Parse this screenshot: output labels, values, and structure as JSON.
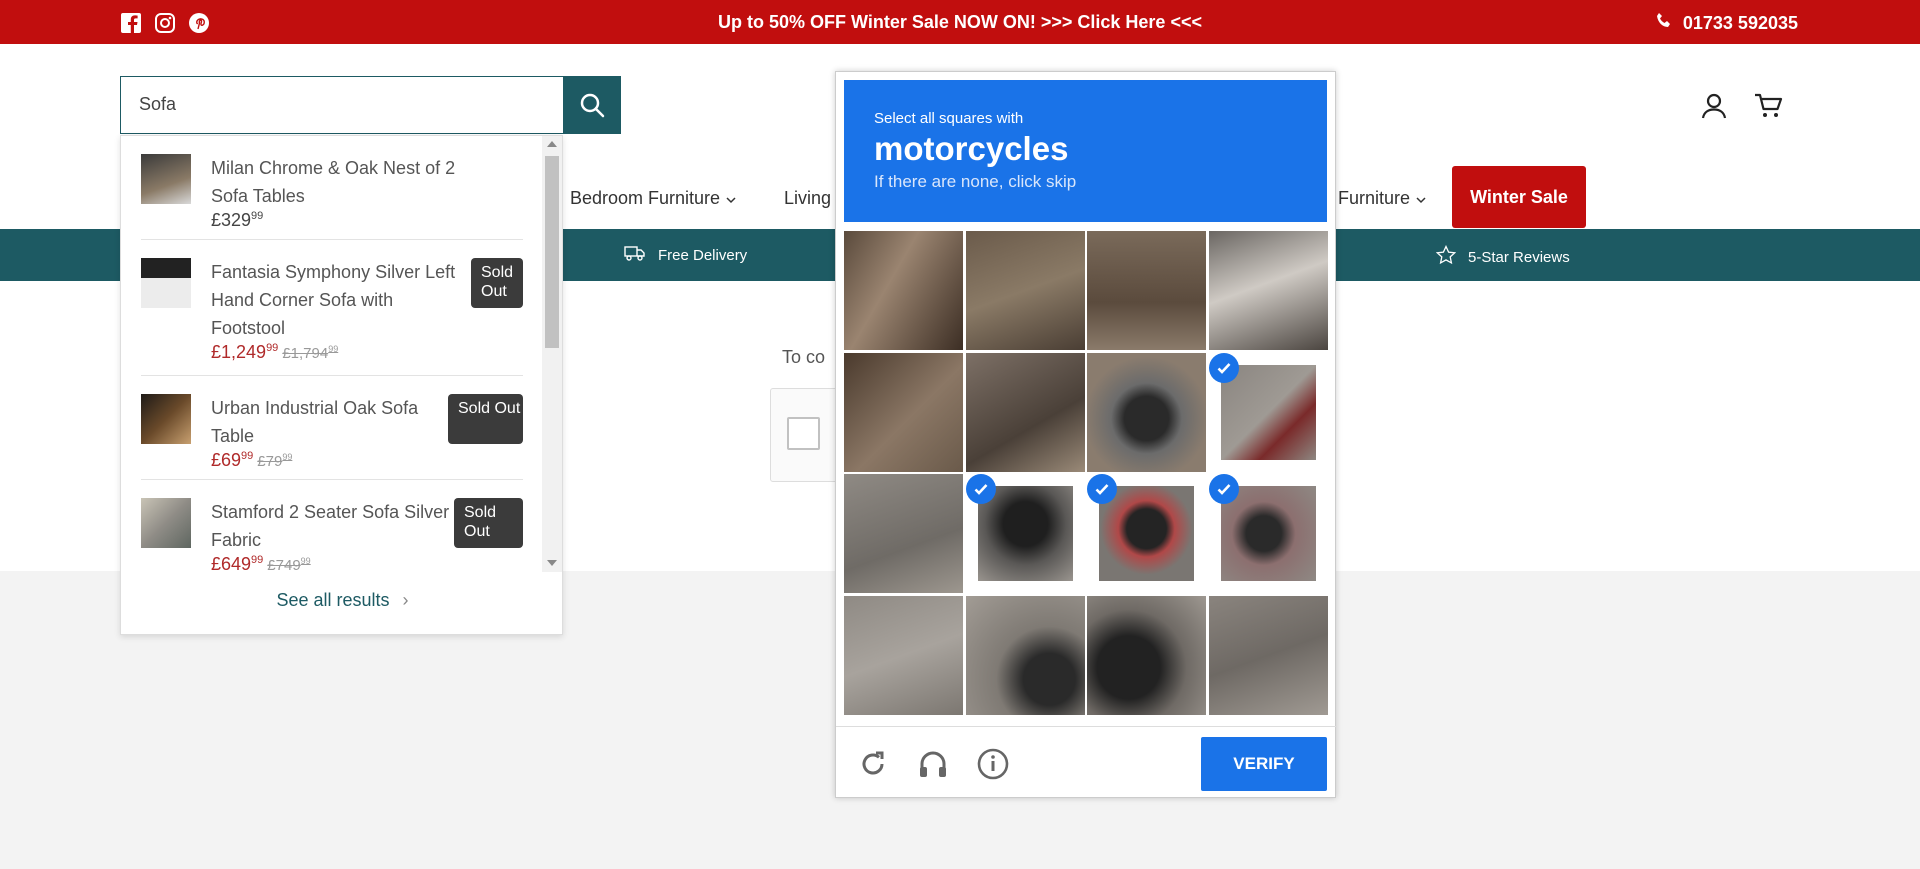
{
  "topbar": {
    "promo": "Up to 50% OFF Winter Sale NOW ON! >>> Click Here <<<",
    "phone": "01733 592035",
    "social": [
      "facebook-icon",
      "instagram-icon",
      "pinterest-icon"
    ],
    "bg_color": "#c10e0e"
  },
  "search": {
    "value": "Sofa",
    "placeholder": "Search"
  },
  "nav": {
    "items": [
      "Bedroom Furniture",
      "Living",
      "Furniture"
    ],
    "sale_label": "Winter Sale"
  },
  "usp": {
    "delivery": "Free Delivery",
    "reviews": "5-Star Reviews"
  },
  "content": {
    "verify_text": "To co"
  },
  "dropdown": {
    "results": [
      {
        "title": "Milan Chrome & Oak Nest of 2 Sofa Tables",
        "price": "£329",
        "price_pence": "99",
        "was": "",
        "was_pence": "",
        "sold_out": ""
      },
      {
        "title": "Fantasia Symphony Silver Left Hand Corner Sofa with Footstool",
        "price": "£1,249",
        "price_pence": "99",
        "was": "£1,794",
        "was_pence": "99",
        "sold_out": "Sold Out"
      },
      {
        "title": "Urban Industrial Oak Sofa Table",
        "price": "£69",
        "price_pence": "99",
        "was": "£79",
        "was_pence": "99",
        "sold_out": "Sold Out"
      },
      {
        "title": "Stamford 2 Seater Sofa Silver Fabric",
        "price": "£649",
        "price_pence": "99",
        "was": "£749",
        "was_pence": "99",
        "sold_out": "Sold Out"
      }
    ],
    "see_all": "See all results"
  },
  "captcha": {
    "instruction": "Select all squares with",
    "target": "motorcycles",
    "hint": "If there are none, click skip",
    "verify_label": "VERIFY",
    "selected_tiles": [
      7,
      9,
      10,
      11
    ],
    "accent": "#1a73e8"
  }
}
